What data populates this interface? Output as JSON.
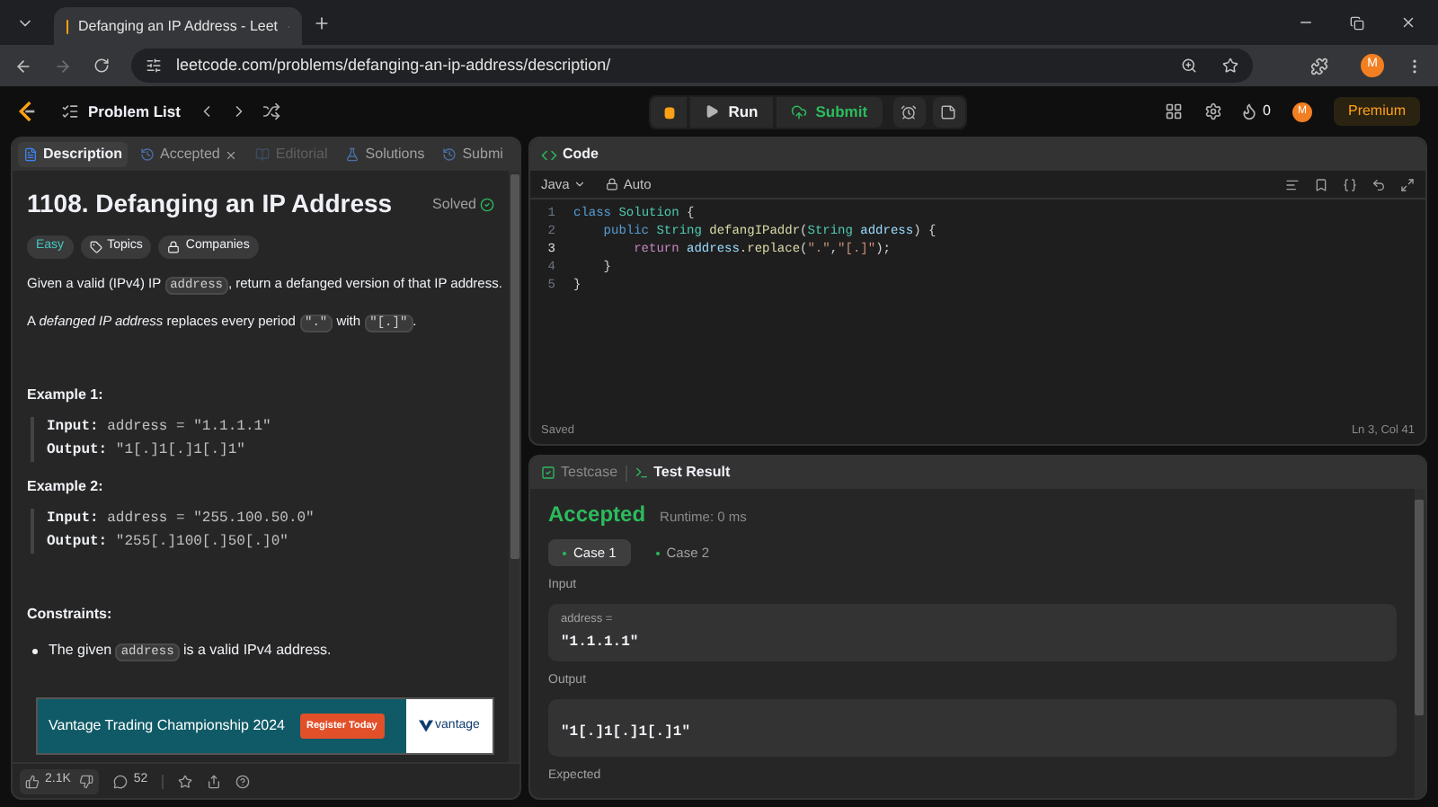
{
  "browser": {
    "tabs": [
      {
        "title": "Defanging an IP Address - Leet",
        "selected": true
      }
    ],
    "url": "leetcode.com/problems/defanging-an-ip-address/description/",
    "profile": "M"
  },
  "nav": {
    "problem_list": "Problem List",
    "run": "Run",
    "submit": "Submit",
    "streak": "0",
    "avatar": "M",
    "premium": "Premium"
  },
  "left_tabs": [
    {
      "label": "Description",
      "selected": true,
      "disabled": false,
      "closable": false
    },
    {
      "label": "Accepted",
      "selected": false,
      "disabled": false,
      "closable": true
    },
    {
      "label": "Editorial",
      "selected": false,
      "disabled": true,
      "closable": false
    },
    {
      "label": "Solutions",
      "selected": false,
      "disabled": false,
      "closable": false
    },
    {
      "label": "Submi",
      "selected": false,
      "disabled": false,
      "closable": false
    }
  ],
  "problem": {
    "title": "1108. Defanging an IP Address",
    "status": "Solved",
    "tags": [
      {
        "label": "Easy",
        "kind": "difficulty"
      },
      {
        "label": "Topics",
        "kind": "topics"
      },
      {
        "label": "Companies",
        "kind": "companies"
      }
    ],
    "paragraphs": [
      [
        {
          "text": "Given a valid (IPv4) IP ",
          "kind": "text"
        },
        {
          "text": "address",
          "kind": "code"
        },
        {
          "text": ", return a defanged version of that IP address.",
          "kind": "text"
        }
      ],
      [
        {
          "text": "A ",
          "kind": "text"
        },
        {
          "text": "defanged IP address",
          "kind": "em"
        },
        {
          "text": " replaces every period ",
          "kind": "text"
        },
        {
          "text": "\".\"",
          "kind": "code"
        },
        {
          "text": " with ",
          "kind": "text"
        },
        {
          "text": "\"[.]\"",
          "kind": "code"
        },
        {
          "text": ".",
          "kind": "text"
        }
      ]
    ],
    "examples": [
      {
        "title": "Example 1:",
        "lines": [
          {
            "label": "Input:",
            "value": "address = \"1.1.1.1\""
          },
          {
            "label": "Output:",
            "value": "\"1[.]1[.]1[.]1\""
          }
        ]
      },
      {
        "title": "Example 2:",
        "lines": [
          {
            "label": "Input:",
            "value": "address = \"255.100.50.0\""
          },
          {
            "label": "Output:",
            "value": "\"255[.]100[.]50[.]0\""
          }
        ]
      }
    ],
    "constraints_title": "Constraints:",
    "constraints": [
      [
        {
          "text": "The given ",
          "kind": "text"
        },
        {
          "text": "address",
          "kind": "code"
        },
        {
          "text": " is a valid IPv4 address.",
          "kind": "text"
        }
      ]
    ]
  },
  "ad": {
    "headline": "Vantage Trading Championship 2024",
    "button": "Register Today",
    "brand": "vantage"
  },
  "footer": {
    "likes": "2.1K",
    "comments": "52"
  },
  "code_panel": {
    "title": "Code",
    "language": "Java",
    "mode": "Auto",
    "status": "Saved",
    "cursor": "Ln 3, Col 41",
    "lines": [
      {
        "number": "1",
        "active": false,
        "tokens": [
          {
            "text": "class ",
            "kind": "keyword"
          },
          {
            "text": "Solution",
            "kind": "type"
          },
          {
            "text": " {",
            "kind": "plain"
          }
        ]
      },
      {
        "number": "2",
        "active": false,
        "tokens": [
          {
            "text": "    public ",
            "kind": "keyword"
          },
          {
            "text": "String ",
            "kind": "type"
          },
          {
            "text": "defangIPaddr",
            "kind": "function"
          },
          {
            "text": "(",
            "kind": "plain"
          },
          {
            "text": "String ",
            "kind": "type"
          },
          {
            "text": "address",
            "kind": "variable"
          },
          {
            "text": ") {",
            "kind": "plain"
          }
        ]
      },
      {
        "number": "3",
        "active": true,
        "tokens": [
          {
            "text": "        return ",
            "kind": "control"
          },
          {
            "text": "address",
            "kind": "variable"
          },
          {
            "text": ".",
            "kind": "plain"
          },
          {
            "text": "replace",
            "kind": "function"
          },
          {
            "text": "(",
            "kind": "plain"
          },
          {
            "text": "\".\"",
            "kind": "string"
          },
          {
            "text": ",",
            "kind": "plain"
          },
          {
            "text": "\"[.]\"",
            "kind": "string"
          },
          {
            "text": ");",
            "kind": "plain"
          }
        ]
      },
      {
        "number": "4",
        "active": false,
        "tokens": [
          {
            "text": "    }",
            "kind": "plain"
          }
        ]
      },
      {
        "number": "5",
        "active": false,
        "tokens": [
          {
            "text": "}",
            "kind": "plain"
          }
        ]
      }
    ]
  },
  "test_panel": {
    "tabs": [
      {
        "label": "Testcase",
        "selected": false
      },
      {
        "label": "Test Result",
        "selected": true
      }
    ],
    "verdict": "Accepted",
    "runtime": "Runtime: 0 ms",
    "cases": [
      {
        "label": "Case 1",
        "selected": true
      },
      {
        "label": "Case 2",
        "selected": false
      }
    ],
    "input_label": "Input",
    "input_var": "address =",
    "input_value": "\"1.1.1.1\"",
    "output_label": "Output",
    "output_value": "\"1[.]1[.]1[.]1\"",
    "expected_label": "Expected"
  }
}
